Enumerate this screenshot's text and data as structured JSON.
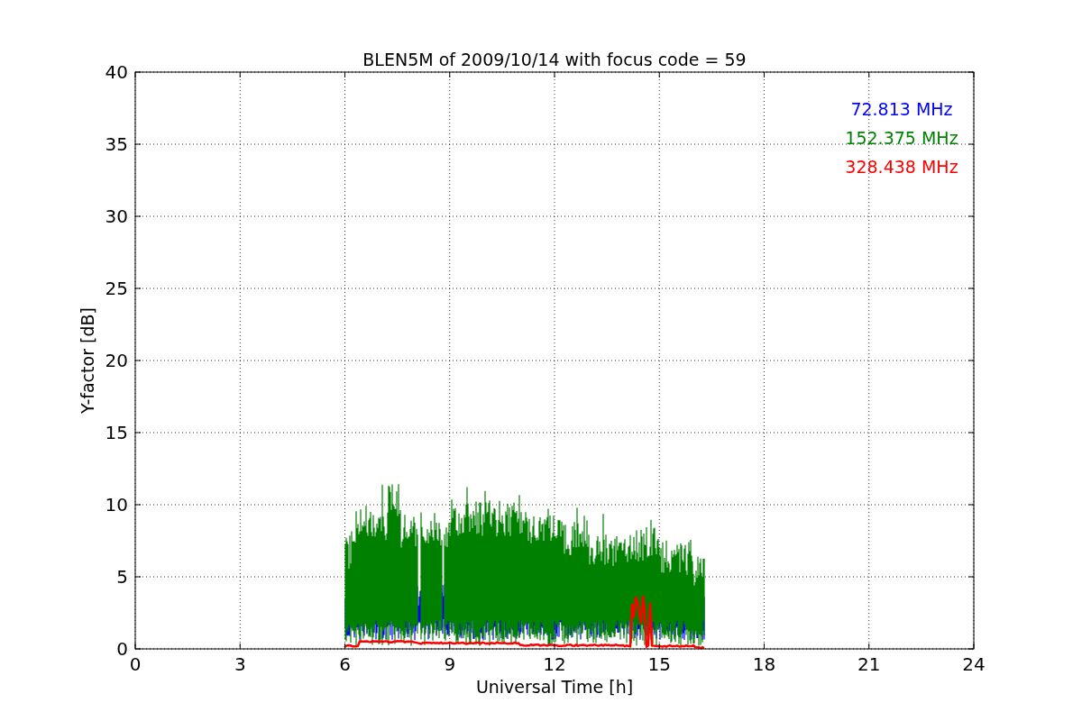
{
  "plot": {
    "title": "BLEN5M of 2009/10/14 with focus code = 59",
    "xlabel": "Universal Time [h]",
    "ylabel": "Y-factor [dB]",
    "x_tick_labels": [
      "0",
      "3",
      "6",
      "9",
      "12",
      "15",
      "18",
      "21",
      "24"
    ],
    "y_tick_labels": [
      "40",
      "35",
      "30",
      "25",
      "20",
      "15",
      "10",
      "5",
      "0"
    ],
    "legend": [
      {
        "label": "72.813 MHz",
        "color": "#0000ff"
      },
      {
        "label": "152.375 MHz",
        "color": "#008000"
      },
      {
        "label": "328.438 MHz",
        "color": "#ff0000"
      }
    ]
  }
}
